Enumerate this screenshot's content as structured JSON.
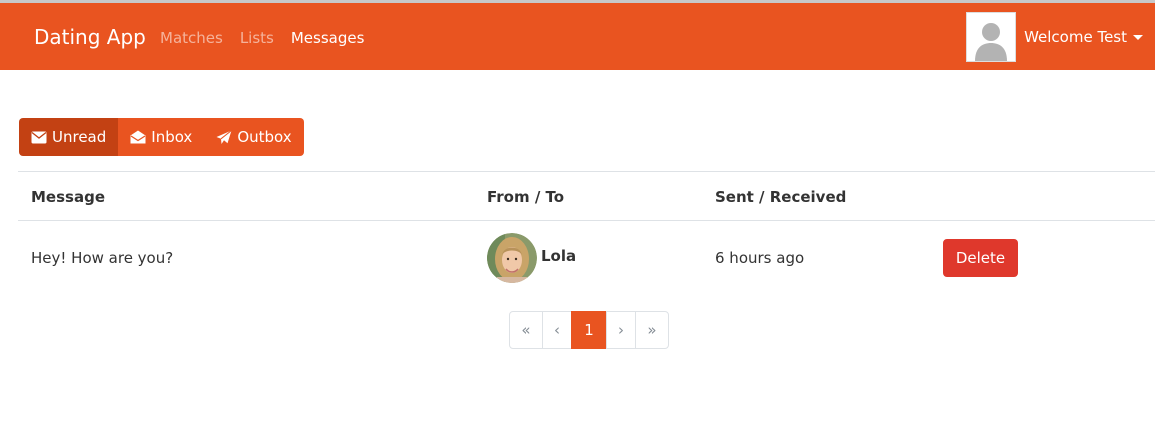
{
  "navbar": {
    "brand": "Dating App",
    "links": [
      {
        "label": "Matches",
        "active": false
      },
      {
        "label": "Lists",
        "active": false
      },
      {
        "label": "Messages",
        "active": true
      }
    ],
    "welcome": "Welcome Test"
  },
  "message_tabs": [
    {
      "label": "Unread",
      "icon": "envelope-icon",
      "active": true
    },
    {
      "label": "Inbox",
      "icon": "envelope-open-icon",
      "active": false
    },
    {
      "label": "Outbox",
      "icon": "paper-plane-icon",
      "active": false
    }
  ],
  "table": {
    "headers": [
      "Message",
      "From / To",
      "Sent / Received"
    ],
    "rows": [
      {
        "message": "Hey! How are you?",
        "person": "Lola",
        "time": "6 hours ago",
        "action": "Delete"
      }
    ]
  },
  "pagination": {
    "first": "«",
    "prev": "‹",
    "current": "1",
    "next": "›",
    "last": "»"
  },
  "colors": {
    "primary": "#e95420",
    "primary_dark": "#c34113",
    "danger": "#df382c",
    "text": "#333333"
  }
}
